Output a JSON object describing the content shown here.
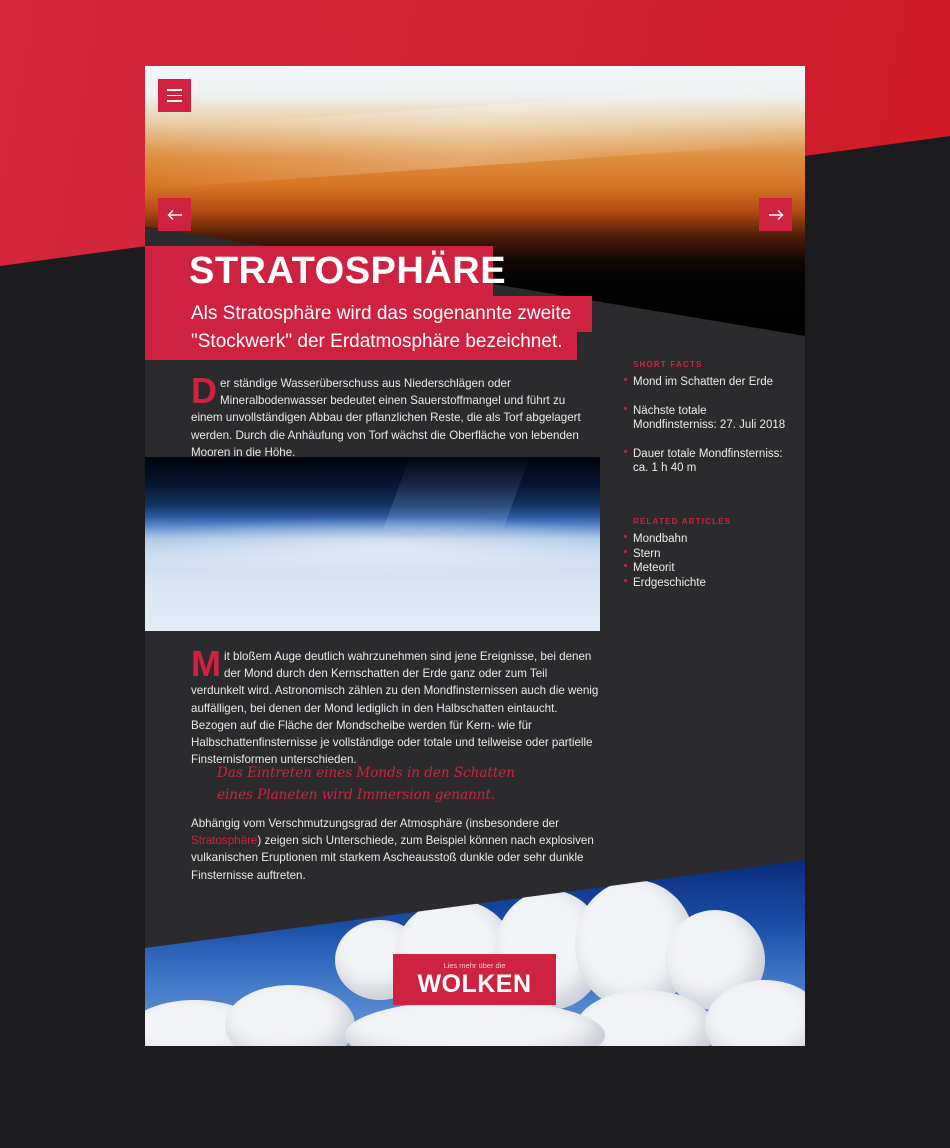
{
  "page": {
    "title": "STRATOSPHÄRE",
    "subtitle": "Als Stratosphäre wird das sogenannte zweite \"Stockwerk\" der Erdatmosphäre bezeichnet."
  },
  "article": {
    "p1": {
      "dropcap": "D",
      "text": "er ständige Wasserüberschuss aus Niederschlägen oder Mineralbodenwasser bedeutet einen Sauerstoffmangel und führt zu einem unvollständigen Abbau der pflanzlichen Reste, die als Torf abgelagert werden. Durch die Anhäufung von Torf wächst die Oberfläche von lebenden Mooren in die Höhe."
    },
    "p2": {
      "dropcap": "M",
      "text": "it bloßem Auge deutlich wahrzunehmen sind jene Ereignisse, bei denen der Mond durch den Kernschatten der Erde ganz oder zum Teil verdunkelt wird. Astronomisch zählen zu den Mondfinsternissen auch die wenig auffälligen, bei denen der Mond lediglich in den Halbschatten eintaucht. Bezogen auf die Fläche der Mondscheibe werden für Kern- wie für Halbschattenfinsternisse je vollständige oder totale und teilweise oder partielle Finsternisformen unterschieden."
    },
    "quote": "Das Eintreten eines Monds in den Schatten eines Planeten wird Immersion genannt.",
    "p3": {
      "before": "Abhängig vom Verschmutzungsgrad der Atmosphäre (insbesondere der ",
      "link": "Stratosphäre",
      "after": ") zeigen sich Unterschiede, zum Beispiel können nach explosiven vulkanischen Eruptionen mit starkem Ascheausstoß dunkle oder sehr dunkle Finsternisse auftreten."
    }
  },
  "sidebar": {
    "facts_heading": "SHORT FACTS",
    "facts": [
      "Mond im Schatten der Erde",
      "Nächste totale Mondfinsterniss: 27. Juli 2018",
      "Dauer totale Mondfinsterniss: ca. 1 h 40 m"
    ],
    "related_heading": "RELATED ARTICLES",
    "related": [
      "Mondbahn",
      "Stern",
      "Meteorit",
      "Erdgeschichte"
    ]
  },
  "cta": {
    "small": "Lies mehr über die",
    "big": "WOLKEN"
  },
  "icons": {
    "menu": "hamburger-menu-icon",
    "prev": "arrow-left-icon",
    "next": "arrow-right-icon"
  },
  "colors": {
    "accent": "#cf2240",
    "background": "#1c1b1e",
    "panel": "#2b2b2d"
  }
}
